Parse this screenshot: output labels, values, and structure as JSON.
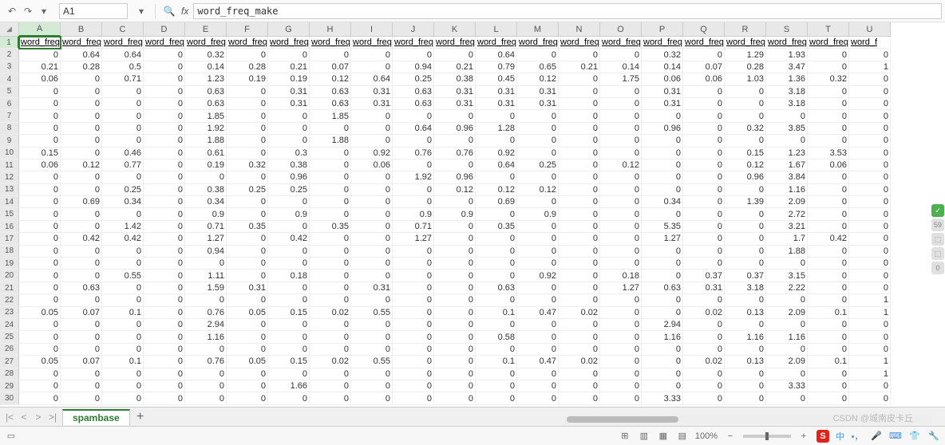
{
  "namebox": "A1",
  "formula": "word_freq_make",
  "sheet_tab": "spambase",
  "zoom": "100%",
  "watermark": "CSDN @城南皮卡丘",
  "columns": [
    "A",
    "B",
    "C",
    "D",
    "E",
    "F",
    "G",
    "H",
    "I",
    "J",
    "K",
    "L",
    "M",
    "N",
    "O",
    "P",
    "Q",
    "R",
    "S",
    "T",
    "U"
  ],
  "rows": [
    "1",
    "2",
    "3",
    "4",
    "5",
    "6",
    "7",
    "8",
    "9",
    "10",
    "11",
    "12",
    "13",
    "14",
    "15",
    "16",
    "17",
    "18",
    "19",
    "20",
    "21",
    "22",
    "23",
    "24",
    "25",
    "26",
    "27",
    "28",
    "29",
    "30"
  ],
  "header_row": [
    "word_freq",
    "word_freq",
    "word_freq",
    "word_freq",
    "word_freq",
    "word_freq",
    "word_freq",
    "word_freq",
    "word_freq",
    "word_freq",
    "word_freq",
    "word_freq",
    "word_freq",
    "word_freq",
    "word_freq",
    "word_freq",
    "word_freq",
    "word_freq",
    "word_freq",
    "word_freq",
    "word_f"
  ],
  "data": [
    [
      "0",
      "0.64",
      "0.64",
      "0",
      "0.32",
      "0",
      "0",
      "0",
      "0",
      "0",
      "0",
      "0.64",
      "0",
      "0",
      "0",
      "0.32",
      "0",
      "1.29",
      "1.93",
      "0",
      "0"
    ],
    [
      "0.21",
      "0.28",
      "0.5",
      "0",
      "0.14",
      "0.28",
      "0.21",
      "0.07",
      "0",
      "0.94",
      "0.21",
      "0.79",
      "0.65",
      "0.21",
      "0.14",
      "0.14",
      "0.07",
      "0.28",
      "3.47",
      "0",
      "1"
    ],
    [
      "0.06",
      "0",
      "0.71",
      "0",
      "1.23",
      "0.19",
      "0.19",
      "0.12",
      "0.64",
      "0.25",
      "0.38",
      "0.45",
      "0.12",
      "0",
      "1.75",
      "0.06",
      "0.06",
      "1.03",
      "1.36",
      "0.32",
      "0"
    ],
    [
      "0",
      "0",
      "0",
      "0",
      "0.63",
      "0",
      "0.31",
      "0.63",
      "0.31",
      "0.63",
      "0.31",
      "0.31",
      "0.31",
      "0",
      "0",
      "0.31",
      "0",
      "0",
      "3.18",
      "0",
      "0"
    ],
    [
      "0",
      "0",
      "0",
      "0",
      "0.63",
      "0",
      "0.31",
      "0.63",
      "0.31",
      "0.63",
      "0.31",
      "0.31",
      "0.31",
      "0",
      "0",
      "0.31",
      "0",
      "0",
      "3.18",
      "0",
      "0"
    ],
    [
      "0",
      "0",
      "0",
      "0",
      "1.85",
      "0",
      "0",
      "1.85",
      "0",
      "0",
      "0",
      "0",
      "0",
      "0",
      "0",
      "0",
      "0",
      "0",
      "0",
      "0",
      "0"
    ],
    [
      "0",
      "0",
      "0",
      "0",
      "1.92",
      "0",
      "0",
      "0",
      "0",
      "0.64",
      "0.96",
      "1.28",
      "0",
      "0",
      "0",
      "0.96",
      "0",
      "0.32",
      "3.85",
      "0",
      "0"
    ],
    [
      "0",
      "0",
      "0",
      "0",
      "1.88",
      "0",
      "0",
      "1.88",
      "0",
      "0",
      "0",
      "0",
      "0",
      "0",
      "0",
      "0",
      "0",
      "0",
      "0",
      "0",
      "0"
    ],
    [
      "0.15",
      "0",
      "0.46",
      "0",
      "0.61",
      "0",
      "0.3",
      "0",
      "0.92",
      "0.76",
      "0.76",
      "0.92",
      "0",
      "0",
      "0",
      "0",
      "0",
      "0.15",
      "1.23",
      "3.53",
      "0"
    ],
    [
      "0.06",
      "0.12",
      "0.77",
      "0",
      "0.19",
      "0.32",
      "0.38",
      "0",
      "0.06",
      "0",
      "0",
      "0.64",
      "0.25",
      "0",
      "0.12",
      "0",
      "0",
      "0.12",
      "1.67",
      "0.06",
      "0"
    ],
    [
      "0",
      "0",
      "0",
      "0",
      "0",
      "0",
      "0.96",
      "0",
      "0",
      "1.92",
      "0.96",
      "0",
      "0",
      "0",
      "0",
      "0",
      "0",
      "0.96",
      "3.84",
      "0",
      "0"
    ],
    [
      "0",
      "0",
      "0.25",
      "0",
      "0.38",
      "0.25",
      "0.25",
      "0",
      "0",
      "0",
      "0.12",
      "0.12",
      "0.12",
      "0",
      "0",
      "0",
      "0",
      "0",
      "1.16",
      "0",
      "0"
    ],
    [
      "0",
      "0.69",
      "0.34",
      "0",
      "0.34",
      "0",
      "0",
      "0",
      "0",
      "0",
      "0",
      "0.69",
      "0",
      "0",
      "0",
      "0.34",
      "0",
      "1.39",
      "2.09",
      "0",
      "0"
    ],
    [
      "0",
      "0",
      "0",
      "0",
      "0.9",
      "0",
      "0.9",
      "0",
      "0",
      "0.9",
      "0.9",
      "0",
      "0.9",
      "0",
      "0",
      "0",
      "0",
      "0",
      "2.72",
      "0",
      "0"
    ],
    [
      "0",
      "0",
      "1.42",
      "0",
      "0.71",
      "0.35",
      "0",
      "0.35",
      "0",
      "0.71",
      "0",
      "0.35",
      "0",
      "0",
      "0",
      "5.35",
      "0",
      "0",
      "3.21",
      "0",
      "0"
    ],
    [
      "0",
      "0.42",
      "0.42",
      "0",
      "1.27",
      "0",
      "0.42",
      "0",
      "0",
      "1.27",
      "0",
      "0",
      "0",
      "0",
      "0",
      "1.27",
      "0",
      "0",
      "1.7",
      "0.42",
      "0"
    ],
    [
      "0",
      "0",
      "0",
      "0",
      "0.94",
      "0",
      "0",
      "0",
      "0",
      "0",
      "0",
      "0",
      "0",
      "0",
      "0",
      "0",
      "0",
      "0",
      "1.88",
      "0",
      "0"
    ],
    [
      "0",
      "0",
      "0",
      "0",
      "0",
      "0",
      "0",
      "0",
      "0",
      "0",
      "0",
      "0",
      "0",
      "0",
      "0",
      "0",
      "0",
      "0",
      "0",
      "0",
      "0"
    ],
    [
      "0",
      "0",
      "0.55",
      "0",
      "1.11",
      "0",
      "0.18",
      "0",
      "0",
      "0",
      "0",
      "0",
      "0.92",
      "0",
      "0.18",
      "0",
      "0.37",
      "0.37",
      "3.15",
      "0",
      "0"
    ],
    [
      "0",
      "0.63",
      "0",
      "0",
      "1.59",
      "0.31",
      "0",
      "0",
      "0.31",
      "0",
      "0",
      "0.63",
      "0",
      "0",
      "1.27",
      "0.63",
      "0.31",
      "3.18",
      "2.22",
      "0",
      "0"
    ],
    [
      "0",
      "0",
      "0",
      "0",
      "0",
      "0",
      "0",
      "0",
      "0",
      "0",
      "0",
      "0",
      "0",
      "0",
      "0",
      "0",
      "0",
      "0",
      "0",
      "0",
      "1"
    ],
    [
      "0.05",
      "0.07",
      "0.1",
      "0",
      "0.76",
      "0.05",
      "0.15",
      "0.02",
      "0.55",
      "0",
      "0",
      "0.1",
      "0.47",
      "0.02",
      "0",
      "0",
      "0.02",
      "0.13",
      "2.09",
      "0.1",
      "1"
    ],
    [
      "0",
      "0",
      "0",
      "0",
      "2.94",
      "0",
      "0",
      "0",
      "0",
      "0",
      "0",
      "0",
      "0",
      "0",
      "0",
      "2.94",
      "0",
      "0",
      "0",
      "0",
      "0"
    ],
    [
      "0",
      "0",
      "0",
      "0",
      "1.16",
      "0",
      "0",
      "0",
      "0",
      "0",
      "0",
      "0.58",
      "0",
      "0",
      "0",
      "1.16",
      "0",
      "1.16",
      "1.16",
      "0",
      "0"
    ],
    [
      "0",
      "0",
      "0",
      "0",
      "0",
      "0",
      "0",
      "0",
      "0",
      "0",
      "0",
      "0",
      "0",
      "0",
      "0",
      "0",
      "0",
      "0",
      "0",
      "0",
      "0"
    ],
    [
      "0.05",
      "0.07",
      "0.1",
      "0",
      "0.76",
      "0.05",
      "0.15",
      "0.02",
      "0.55",
      "0",
      "0",
      "0.1",
      "0.47",
      "0.02",
      "0",
      "0",
      "0.02",
      "0.13",
      "2.09",
      "0.1",
      "1"
    ],
    [
      "0",
      "0",
      "0",
      "0",
      "0",
      "0",
      "0",
      "0",
      "0",
      "0",
      "0",
      "0",
      "0",
      "0",
      "0",
      "0",
      "0",
      "0",
      "0",
      "0",
      "1"
    ],
    [
      "0",
      "0",
      "0",
      "0",
      "0",
      "0",
      "1.66",
      "0",
      "0",
      "0",
      "0",
      "0",
      "0",
      "0",
      "0",
      "0",
      "0",
      "0",
      "3.33",
      "0",
      "0"
    ],
    [
      "0",
      "0",
      "0",
      "0",
      "0",
      "0",
      "0",
      "0",
      "0",
      "0",
      "0",
      "0",
      "0",
      "0",
      "0",
      "3.33",
      "0",
      "0",
      "0",
      "0",
      "0"
    ]
  ],
  "side_badges": [
    "✓",
    "59",
    "",
    "",
    "0"
  ]
}
